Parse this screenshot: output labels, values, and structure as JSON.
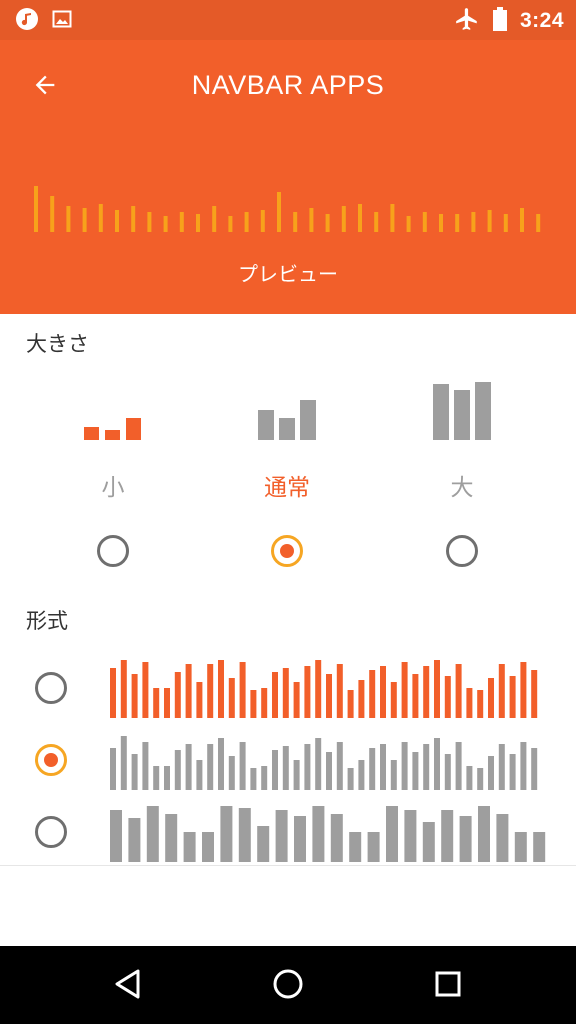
{
  "status_bar": {
    "time": "3:24",
    "left_icons": [
      "music-note-icon",
      "image-icon"
    ],
    "right_icons": [
      "airplane-icon",
      "battery-icon"
    ]
  },
  "app_bar": {
    "title": "NAVBAR APPS",
    "back_icon": "arrow-left-icon",
    "preview_label": "プレビュー"
  },
  "size_section": {
    "title": "大きさ",
    "options": [
      {
        "label": "小",
        "selected": false
      },
      {
        "label": "通常",
        "selected": true
      },
      {
        "label": "大",
        "selected": false
      }
    ]
  },
  "format_section": {
    "title": "形式",
    "options": [
      {
        "style": "thin-bars",
        "selected": false
      },
      {
        "style": "thin-bars",
        "selected": true
      },
      {
        "style": "thick-bars",
        "selected": false
      }
    ]
  },
  "nav_bar": {
    "buttons": [
      "back-triangle-icon",
      "home-circle-icon",
      "recents-square-icon"
    ]
  },
  "colors": {
    "accent": "#f25f2a",
    "status_bar": "#e45a28",
    "radio_ring_selected": "#f6a623",
    "inactive_gray": "#9e9e9e",
    "preview_bar": "#f7a21b"
  }
}
